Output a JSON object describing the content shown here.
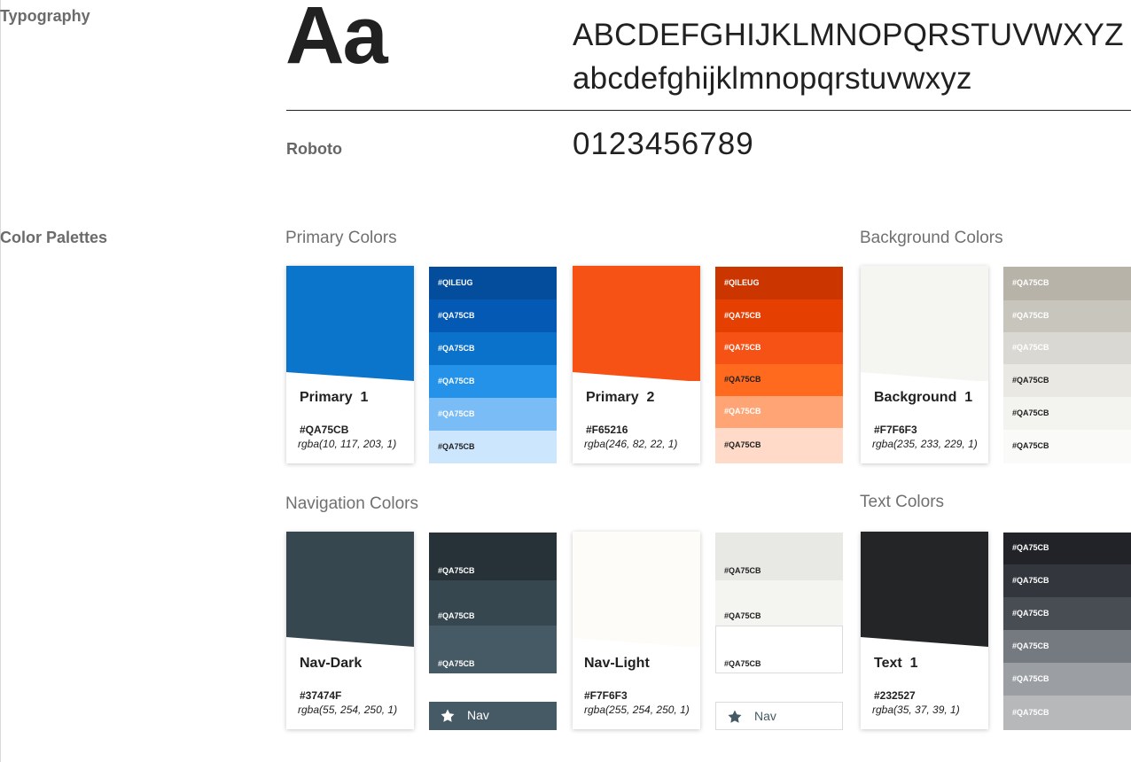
{
  "typography": {
    "section_label": "Typography",
    "sample_glyph": "Aa",
    "uppercase": "ABCDEFGHIJKLMNOPQRSTUVWXYZ",
    "lowercase": "abcdefghijklmnopqrstuvwxyz",
    "font_name": "Roboto",
    "digits": "0123456789"
  },
  "palettes": {
    "section_label": "Color Palettes",
    "primary_title": "Primary Colors",
    "background_title": "Background Colors",
    "navigation_title": "Navigation Colors",
    "text_title": "Text Colors",
    "cards": [
      {
        "name": "Primary  1",
        "hex": "#QA75CB",
        "rgba": "rgba(10, 117, 203, 1)",
        "color": "#0a75cb"
      },
      {
        "name": "Primary  2",
        "hex": "#F65216",
        "rgba": "rgba(246, 82, 22, 1)",
        "color": "#f65216"
      },
      {
        "name": "Background  1",
        "hex": "#F7F6F3",
        "rgba": "rgba(235, 233, 229, 1)",
        "color": "#f5f5f1"
      },
      {
        "name": "Nav-Dark",
        "hex": "#37474F",
        "rgba": "rgba(55, 254, 250, 1)",
        "color": "#37474f"
      },
      {
        "name": "Nav-Light",
        "hex": "#F7F6F3",
        "rgba": "rgba(255, 254, 250, 1)",
        "color": "#fdfcf8"
      },
      {
        "name": "Text  1",
        "hex": "#232527",
        "rgba": "rgba(35, 37, 39, 1)",
        "color": "#232527"
      }
    ],
    "shade_sets": [
      {
        "items": [
          {
            "label": "#QILEUG",
            "color": "#034d9c",
            "text": "#ffffff"
          },
          {
            "label": "#QA75CB",
            "color": "#0459b4",
            "text": "#ffffff"
          },
          {
            "label": "#QA75CB",
            "color": "#0a72ca",
            "text": "#ffffff"
          },
          {
            "label": "#QA75CB",
            "color": "#2392e8",
            "text": "#ffffff"
          },
          {
            "label": "#QA75CB",
            "color": "#79bcf6",
            "text": "#ffffff"
          },
          {
            "label": "#QA75CB",
            "color": "#cce6fd",
            "text": "#212121"
          }
        ]
      },
      {
        "items": [
          {
            "label": "#QILEUG",
            "color": "#cb3600",
            "text": "#ffffff"
          },
          {
            "label": "#QA75CB",
            "color": "#e63f02",
            "text": "#ffffff"
          },
          {
            "label": "#QA75CB",
            "color": "#f65216",
            "text": "#ffffff"
          },
          {
            "label": "#QA75CB",
            "color": "#ff6a1e",
            "text": "#212121"
          },
          {
            "label": "#QA75CB",
            "color": "#ffa575",
            "text": "#ffffff"
          },
          {
            "label": "#QA75CB",
            "color": "#ffdac8",
            "text": "#212121"
          }
        ]
      },
      {
        "items": [
          {
            "label": "#QA75CB",
            "color": "#b8b3a8",
            "text": "#ffffff"
          },
          {
            "label": "#QA75CB",
            "color": "#c8c6bc",
            "text": "#ffffff"
          },
          {
            "label": "#QA75CB",
            "color": "#dad8d2",
            "text": "#ffffff"
          },
          {
            "label": "#QA75CB",
            "color": "#e9e8e3",
            "text": "#212121"
          },
          {
            "label": "#QA75CB",
            "color": "#f3f3ef",
            "text": "#212121"
          },
          {
            "label": "#QA75CB",
            "color": "#fafaf8",
            "text": "#212121"
          }
        ]
      },
      {
        "items": [
          {
            "label": "#QA75CB",
            "color": "#263238",
            "text": "#ffffff"
          },
          {
            "label": "#QA75CB",
            "color": "#37474f",
            "text": "#ffffff"
          },
          {
            "label": "#QA75CB",
            "color": "#455a64",
            "text": "#ffffff"
          }
        ],
        "nav": {
          "label": "Nav",
          "icon": "star-icon",
          "color": "#455a64",
          "text": "#ffffff"
        }
      },
      {
        "items": [
          {
            "label": "#QA75CB",
            "color": "#e8e8e5",
            "text": "#212121"
          },
          {
            "label": "#QA75CB",
            "color": "#f4f4f1",
            "text": "#212121"
          },
          {
            "label": "#QA75CB",
            "color": "#ffffff",
            "text": "#212121"
          }
        ],
        "nav": {
          "label": "Nav",
          "icon": "star-icon",
          "color": "#ffffff",
          "text": "#455a64"
        }
      },
      {
        "items": [
          {
            "label": "#QA75CB",
            "color": "#212328",
            "text": "#ffffff"
          },
          {
            "label": "#QA75CB",
            "color": "#33373d",
            "text": "#ffffff"
          },
          {
            "label": "#QA75CB",
            "color": "#484d54",
            "text": "#ffffff"
          },
          {
            "label": "#QA75CB",
            "color": "#747a80",
            "text": "#ffffff"
          },
          {
            "label": "#QA75CB",
            "color": "#9b9fa3",
            "text": "#ffffff"
          },
          {
            "label": "#QA75CB",
            "color": "#b6b8ba",
            "text": "#ffffff"
          }
        ]
      }
    ]
  }
}
